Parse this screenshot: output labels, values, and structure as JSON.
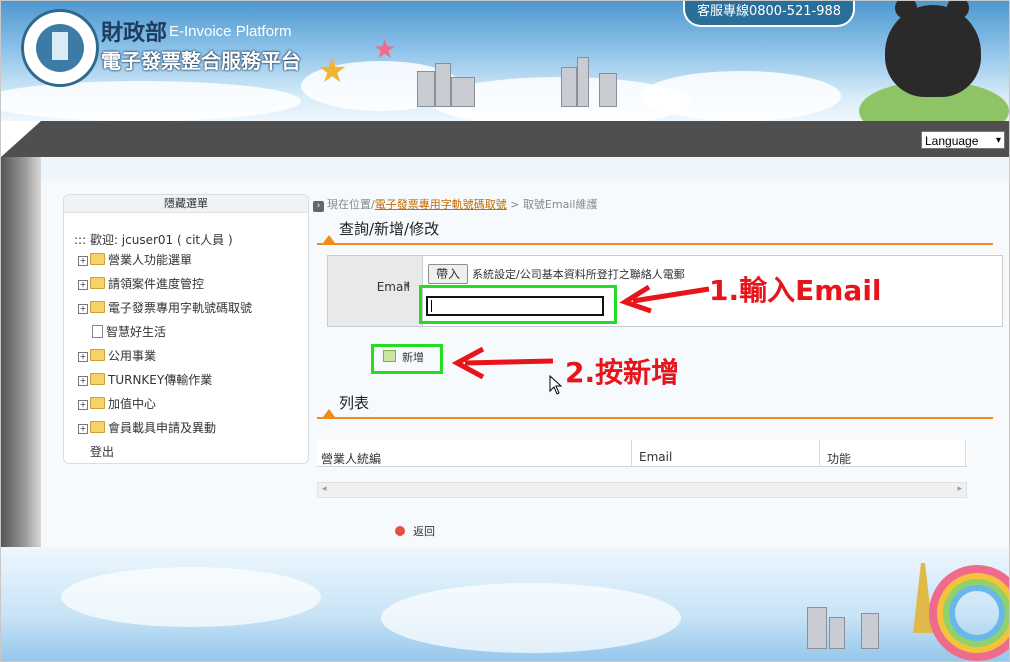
{
  "header": {
    "org_name": "財政部",
    "org_en": "E-Invoice Platform",
    "platform_name": "電子發票整合服務平台",
    "hotline": "客服專線0800-521-988"
  },
  "language": {
    "label": "Language",
    "arrow": "▾"
  },
  "sidebar": {
    "title": "隱藏選單",
    "welcome": "::: 歡迎: jcuser01 ( cit人員 )",
    "items": [
      {
        "label": "營業人功能選單",
        "icon": "folder"
      },
      {
        "label": "請領案件進度管控",
        "icon": "folder"
      },
      {
        "label": "電子發票專用字軌號碼取號",
        "icon": "folder"
      },
      {
        "label": "智慧好生活",
        "icon": "doc"
      },
      {
        "label": "公用事業",
        "icon": "folder"
      },
      {
        "label": "TURNKEY傳輸作業",
        "icon": "folder"
      },
      {
        "label": "加值中心",
        "icon": "folder"
      },
      {
        "label": "會員載具申請及異動",
        "icon": "folder"
      },
      {
        "label": "登出",
        "icon": "none"
      }
    ]
  },
  "breadcrumb": {
    "prefix": "現在位置/",
    "link": "電子發票專用字軌號碼取號",
    "separator": " > ",
    "current": "取號Email維護"
  },
  "query_section": {
    "title": "查詢/新增/修改"
  },
  "form": {
    "email_label": "Email",
    "required_mark": "*",
    "import_button": "帶入",
    "hint": "系統設定/公司基本資料所登打之聯絡人電郵",
    "email_value": ""
  },
  "add_button": {
    "label": "新增"
  },
  "annotations": {
    "step1": "1.輸入Email",
    "step2": "2.按新增",
    "color": "#e8141c",
    "highlight_color": "#22dd22"
  },
  "list_section": {
    "title": "列表",
    "columns": [
      "營業人統編",
      "Email",
      "功能"
    ]
  },
  "back": {
    "label": "返回"
  }
}
